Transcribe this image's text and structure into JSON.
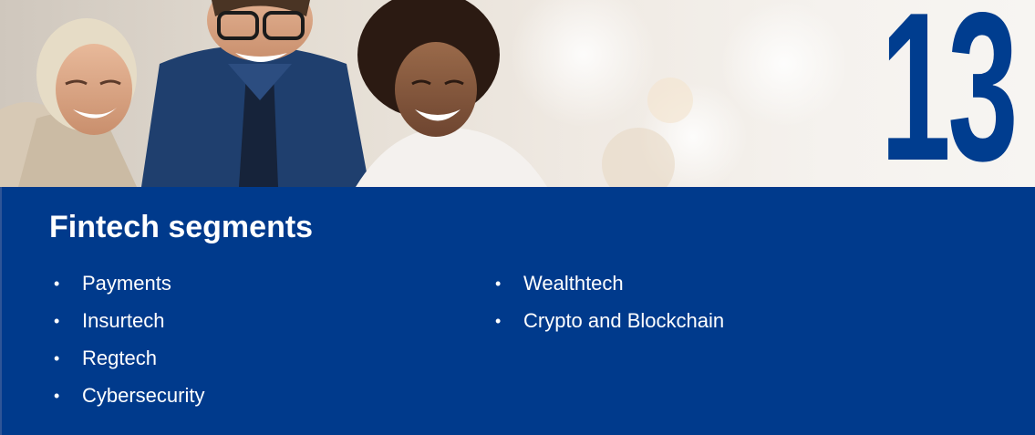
{
  "slide": {
    "number": "13",
    "title": "Fintech segments",
    "bullet_glyph": "•",
    "left_column": [
      "Payments",
      "Insurtech",
      "Regtech",
      "Cybersecurity"
    ],
    "right_column": [
      "Wealthtech",
      "Crypto and Blockchain"
    ]
  },
  "colors": {
    "panel_blue": "#003a8c",
    "number_blue": "#003d8f",
    "text": "#ffffff"
  },
  "icons": {
    "hero": "people-laughing-photo"
  }
}
